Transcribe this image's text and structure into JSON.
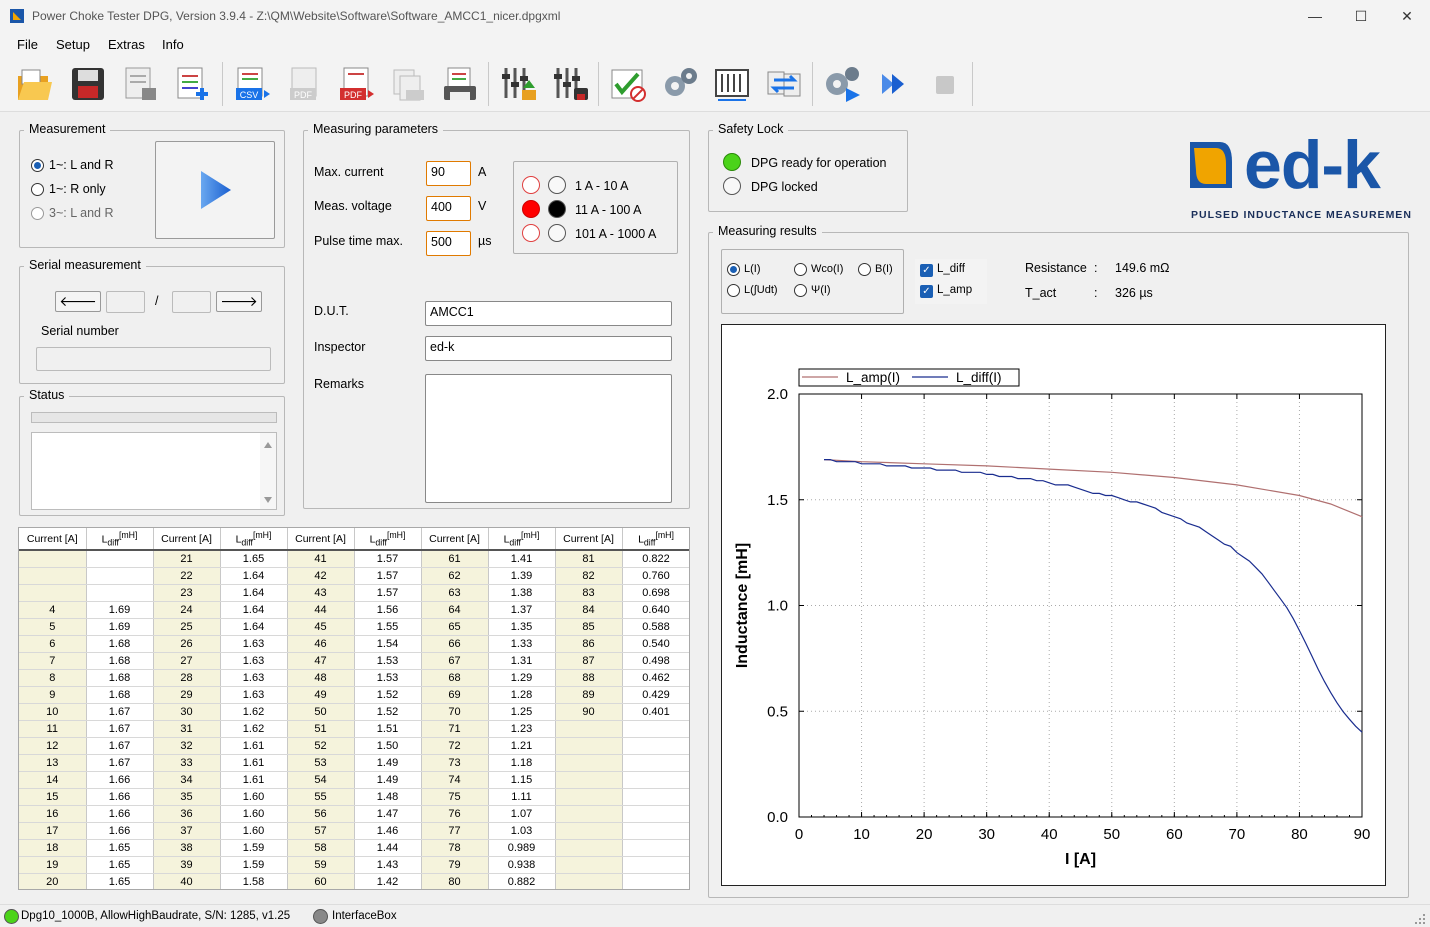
{
  "window": {
    "title": "Power Choke Tester DPG, Version 3.9.4 - Z:\\QM\\Website\\Software\\Software_AMCC1_nicer.dpgxml",
    "minimize": "—",
    "maximize": "☐",
    "close": "✕"
  },
  "menu": {
    "file": "File",
    "setup": "Setup",
    "extras": "Extras",
    "info": "Info"
  },
  "toolbar": {
    "icons": [
      "open-folder-icon",
      "save-icon",
      "save-as-icon",
      "add-file-icon",
      "export-csv-icon",
      "export-pdf-disabled-icon",
      "export-pdf-icon",
      "print-preview-icon",
      "print-icon",
      "settings-load-icon",
      "settings-save-icon",
      "calibration-icon",
      "gears-icon",
      "scale-axis-icon",
      "compare-icon",
      "auto-measure-icon",
      "run-series-icon",
      "stop-icon"
    ],
    "csv_label": "CSV",
    "pdf_label": "PDF"
  },
  "measurement": {
    "title": "Measurement",
    "options": [
      {
        "label": "1~: L and R",
        "selected": true,
        "enabled": true
      },
      {
        "label": "1~: R only",
        "selected": false,
        "enabled": true
      },
      {
        "label": "3~: L and R",
        "selected": false,
        "enabled": false
      }
    ]
  },
  "serial": {
    "title": "Serial measurement",
    "prev": "🡐",
    "separator": "/",
    "next": "🡒",
    "serial_label": "Serial number",
    "serial_value": "",
    "current_index": "",
    "total": ""
  },
  "status": {
    "title": "Status",
    "text": ""
  },
  "params": {
    "title": "Measuring parameters",
    "max_current": {
      "label": "Max. current",
      "value": "90",
      "unit": "A"
    },
    "meas_voltage": {
      "label": "Meas. voltage",
      "value": "400",
      "unit": "V"
    },
    "pulse_time": {
      "label": "Pulse time max.",
      "value": "500",
      "unit": "µs"
    },
    "ranges": [
      "1 A - 10 A",
      "11 A - 100 A",
      "101 A - 1000 A"
    ],
    "dut": {
      "label": "D.U.T.",
      "value": "AMCC1"
    },
    "inspector": {
      "label": "Inspector",
      "value": "ed-k"
    },
    "remarks": {
      "label": "Remarks",
      "value": ""
    }
  },
  "safety": {
    "title": "Safety Lock",
    "ready": "DPG ready for operation",
    "locked": "DPG locked",
    "ready_color": "#4bd319"
  },
  "logo": {
    "text": "ed-k",
    "tagline": "PULSED INDUCTANCE MEASUREMENT",
    "brand_blue": "#1a56a8",
    "accent_orange": "#f0a400"
  },
  "results": {
    "title": "Measuring results",
    "modes": [
      {
        "label": "L(I)",
        "selected": true
      },
      {
        "label": "Wco(I)",
        "selected": false
      },
      {
        "label": "B(I)",
        "selected": false
      },
      {
        "label": "L(∫Udt)",
        "selected": false
      },
      {
        "label": "Ψ(I)",
        "selected": false
      }
    ],
    "checks": [
      {
        "label": "L_diff",
        "checked": true
      },
      {
        "label": "L_amp",
        "checked": true
      }
    ],
    "check_mark": "✓",
    "resistance_label": "Resistance",
    "resistance_value": "149.6 mΩ",
    "tact_label": "T_act",
    "tact_value": "326 µs",
    "colon": ":"
  },
  "table": {
    "headers": [
      {
        "current": "Current [A]",
        "l": "L",
        "sub": "diff",
        "unit": "[mH]"
      }
    ],
    "rows": [
      [
        "",
        "",
        "21",
        "1.65",
        "41",
        "1.57",
        "61",
        "1.41",
        "81",
        "0.822"
      ],
      [
        "",
        "",
        "22",
        "1.64",
        "42",
        "1.57",
        "62",
        "1.39",
        "82",
        "0.760"
      ],
      [
        "",
        "",
        "23",
        "1.64",
        "43",
        "1.57",
        "63",
        "1.38",
        "83",
        "0.698"
      ],
      [
        "4",
        "1.69",
        "24",
        "1.64",
        "44",
        "1.56",
        "64",
        "1.37",
        "84",
        "0.640"
      ],
      [
        "5",
        "1.69",
        "25",
        "1.64",
        "45",
        "1.55",
        "65",
        "1.35",
        "85",
        "0.588"
      ],
      [
        "6",
        "1.68",
        "26",
        "1.63",
        "46",
        "1.54",
        "66",
        "1.33",
        "86",
        "0.540"
      ],
      [
        "7",
        "1.68",
        "27",
        "1.63",
        "47",
        "1.53",
        "67",
        "1.31",
        "87",
        "0.498"
      ],
      [
        "8",
        "1.68",
        "28",
        "1.63",
        "48",
        "1.53",
        "68",
        "1.29",
        "88",
        "0.462"
      ],
      [
        "9",
        "1.68",
        "29",
        "1.63",
        "49",
        "1.52",
        "69",
        "1.28",
        "89",
        "0.429"
      ],
      [
        "10",
        "1.67",
        "30",
        "1.62",
        "50",
        "1.52",
        "70",
        "1.25",
        "90",
        "0.401"
      ],
      [
        "11",
        "1.67",
        "31",
        "1.62",
        "51",
        "1.51",
        "71",
        "1.23",
        "",
        ""
      ],
      [
        "12",
        "1.67",
        "32",
        "1.61",
        "52",
        "1.50",
        "72",
        "1.21",
        "",
        ""
      ],
      [
        "13",
        "1.67",
        "33",
        "1.61",
        "53",
        "1.49",
        "73",
        "1.18",
        "",
        ""
      ],
      [
        "14",
        "1.66",
        "34",
        "1.61",
        "54",
        "1.49",
        "74",
        "1.15",
        "",
        ""
      ],
      [
        "15",
        "1.66",
        "35",
        "1.60",
        "55",
        "1.48",
        "75",
        "1.11",
        "",
        ""
      ],
      [
        "16",
        "1.66",
        "36",
        "1.60",
        "56",
        "1.47",
        "76",
        "1.07",
        "",
        ""
      ],
      [
        "17",
        "1.66",
        "37",
        "1.60",
        "57",
        "1.46",
        "77",
        "1.03",
        "",
        ""
      ],
      [
        "18",
        "1.65",
        "38",
        "1.59",
        "58",
        "1.44",
        "78",
        "0.989",
        "",
        ""
      ],
      [
        "19",
        "1.65",
        "39",
        "1.59",
        "59",
        "1.43",
        "79",
        "0.938",
        "",
        ""
      ],
      [
        "20",
        "1.65",
        "40",
        "1.58",
        "60",
        "1.42",
        "80",
        "0.882",
        "",
        ""
      ]
    ]
  },
  "chart_data": {
    "type": "line",
    "xlabel": "I [A]",
    "ylabel": "Inductance [mH]",
    "xlim": [
      0,
      90
    ],
    "ylim": [
      0.0,
      2.0
    ],
    "xticks": [
      "0",
      "10",
      "20",
      "30",
      "40",
      "50",
      "60",
      "70",
      "80",
      "90"
    ],
    "yticks": [
      "0.0",
      "0.5",
      "1.0",
      "1.5",
      "2.0"
    ],
    "legend_position": "top-left",
    "grid": true,
    "series": [
      {
        "name": "L_amp(I)",
        "color": "#b07070",
        "x": [
          4,
          10,
          20,
          30,
          40,
          50,
          60,
          70,
          80,
          85,
          90
        ],
        "y": [
          1.69,
          1.68,
          1.67,
          1.66,
          1.645,
          1.63,
          1.605,
          1.57,
          1.52,
          1.48,
          1.42
        ]
      },
      {
        "name": "L_diff(I)",
        "color": "#1a2d8f",
        "x": [
          4,
          5,
          6,
          7,
          8,
          9,
          10,
          11,
          12,
          13,
          14,
          15,
          16,
          17,
          18,
          19,
          20,
          21,
          22,
          23,
          24,
          25,
          26,
          27,
          28,
          29,
          30,
          31,
          32,
          33,
          34,
          35,
          36,
          37,
          38,
          39,
          40,
          41,
          42,
          43,
          44,
          45,
          46,
          47,
          48,
          49,
          50,
          51,
          52,
          53,
          54,
          55,
          56,
          57,
          58,
          59,
          60,
          61,
          62,
          63,
          64,
          65,
          66,
          67,
          68,
          69,
          70,
          71,
          72,
          73,
          74,
          75,
          76,
          77,
          78,
          79,
          80,
          81,
          82,
          83,
          84,
          85,
          86,
          87,
          88,
          89,
          90
        ],
        "y": [
          1.69,
          1.69,
          1.68,
          1.68,
          1.68,
          1.68,
          1.67,
          1.67,
          1.67,
          1.67,
          1.66,
          1.66,
          1.66,
          1.66,
          1.65,
          1.65,
          1.65,
          1.65,
          1.64,
          1.64,
          1.64,
          1.64,
          1.63,
          1.63,
          1.63,
          1.63,
          1.62,
          1.62,
          1.61,
          1.61,
          1.61,
          1.6,
          1.6,
          1.6,
          1.59,
          1.59,
          1.58,
          1.57,
          1.57,
          1.57,
          1.56,
          1.55,
          1.54,
          1.53,
          1.53,
          1.52,
          1.52,
          1.51,
          1.5,
          1.49,
          1.49,
          1.48,
          1.47,
          1.46,
          1.44,
          1.43,
          1.42,
          1.41,
          1.39,
          1.38,
          1.37,
          1.35,
          1.33,
          1.31,
          1.29,
          1.28,
          1.25,
          1.23,
          1.21,
          1.18,
          1.15,
          1.11,
          1.07,
          1.03,
          0.989,
          0.938,
          0.882,
          0.822,
          0.76,
          0.698,
          0.64,
          0.588,
          0.54,
          0.498,
          0.462,
          0.429,
          0.401
        ]
      }
    ]
  },
  "statusbar": {
    "device": "Dpg10_1000B, AllowHighBaudrate, S/N: 1285, v1.25",
    "interface": "InterfaceBox",
    "device_color": "#4bd319",
    "interface_color": "#888888"
  }
}
